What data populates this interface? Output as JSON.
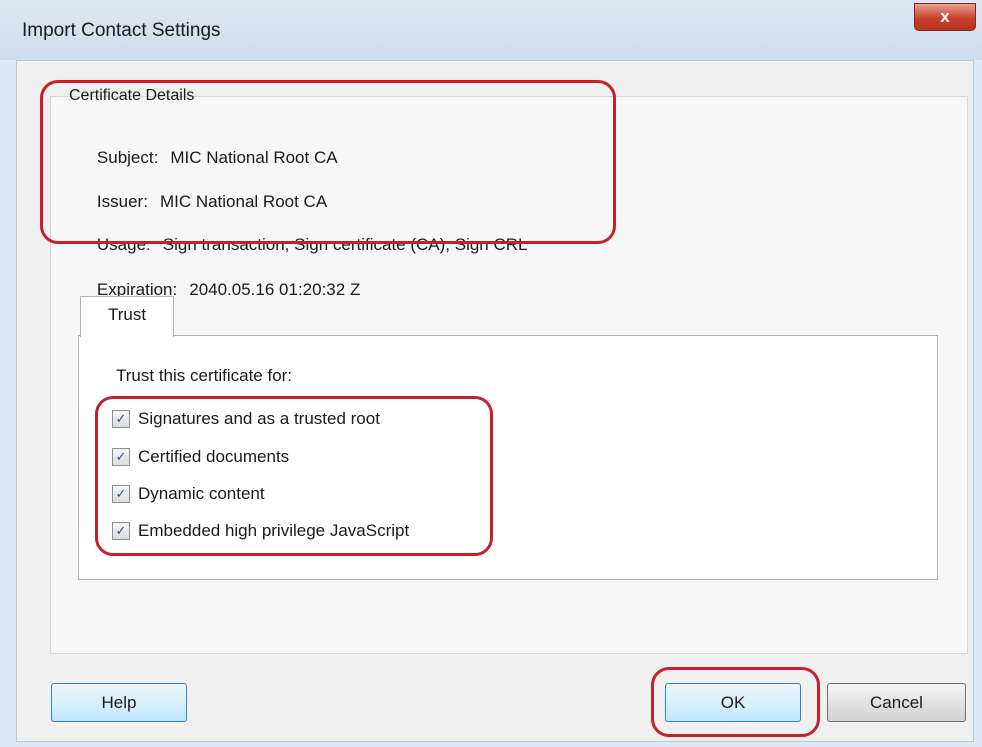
{
  "window": {
    "title": "Import Contact Settings",
    "close_label": "x"
  },
  "details": {
    "group_label": "Certificate Details",
    "subject_label": "Subject:",
    "subject_value": "MIC National Root CA",
    "issuer_label": "Issuer:",
    "issuer_value": "MIC National Root CA",
    "usage_label": "Usage:",
    "usage_value": "Sign transaction, Sign certificate (CA), Sign CRL",
    "expiration_label": "Expiration:",
    "expiration_value": "2040.05.16 01:20:32 Z"
  },
  "trust": {
    "tab_label": "Trust",
    "caption": "Trust this certificate for:",
    "options": [
      {
        "label": "Signatures and as a trusted root",
        "checked": true
      },
      {
        "label": "Certified documents",
        "checked": true
      },
      {
        "label": "Dynamic content",
        "checked": true
      },
      {
        "label": "Embedded high privilege JavaScript",
        "checked": true
      }
    ]
  },
  "buttons": {
    "help": "Help",
    "ok": "OK",
    "cancel": "Cancel"
  },
  "annotation_color": "#c8202a"
}
